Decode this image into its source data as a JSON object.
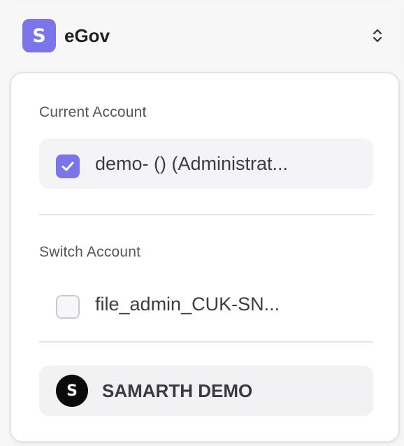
{
  "org_switcher": {
    "logo_letter": "S",
    "name": "eGov",
    "toggle_icon": "chevron-up-down-icon"
  },
  "dropdown": {
    "current_section": {
      "label": "Current Account",
      "account": {
        "text": "demo- () (Administrat...",
        "checked": true
      }
    },
    "switch_section": {
      "label": "Switch Account",
      "accounts": [
        {
          "text": "file_admin_CUK-SN...",
          "checked": false
        }
      ]
    },
    "organization": {
      "avatar_letter": "S",
      "name": "SAMARTH DEMO"
    }
  },
  "colors": {
    "accent": "#7c74e9",
    "panel_bg": "#ffffff",
    "row_bg": "#f4f4f7",
    "avatar_bg": "#0b0b0c"
  }
}
